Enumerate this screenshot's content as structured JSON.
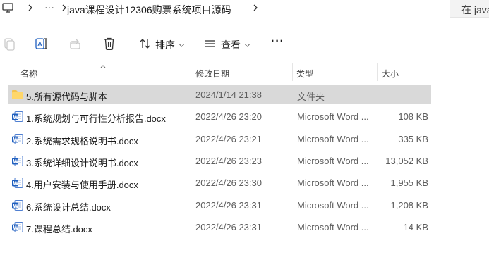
{
  "address": {
    "ellipsis": "···",
    "path": "java课程设计12306购票系统项目源码",
    "search_placeholder": "在 java"
  },
  "toolbar": {
    "sort_label": "排序",
    "view_label": "查看",
    "more_label": "···"
  },
  "columns": {
    "name": "名称",
    "modified": "修改日期",
    "type": "类型",
    "size": "大小"
  },
  "files": [
    {
      "name": "5.所有源代码与脚本",
      "modified": "2024/1/14 21:38",
      "type": "文件夹",
      "size": "",
      "icon": "folder-icon",
      "selected": true
    },
    {
      "name": "1.系统规划与可行性分析报告.docx",
      "modified": "2022/4/26 23:20",
      "type": "Microsoft Word ...",
      "size": "108 KB",
      "icon": "word-doc-icon",
      "selected": false
    },
    {
      "name": "2.系统需求规格说明书.docx",
      "modified": "2022/4/26 23:21",
      "type": "Microsoft Word ...",
      "size": "335 KB",
      "icon": "word-doc-icon",
      "selected": false
    },
    {
      "name": "3.系统详细设计说明书.docx",
      "modified": "2022/4/26 23:23",
      "type": "Microsoft Word ...",
      "size": "13,052 KB",
      "icon": "word-doc-icon",
      "selected": false
    },
    {
      "name": "4.用户安装与使用手册.docx",
      "modified": "2022/4/26 23:30",
      "type": "Microsoft Word ...",
      "size": "1,955 KB",
      "icon": "word-doc-icon",
      "selected": false
    },
    {
      "name": "6.系统设计总结.docx",
      "modified": "2022/4/26 23:31",
      "type": "Microsoft Word ...",
      "size": "1,208 KB",
      "icon": "word-doc-icon",
      "selected": false
    },
    {
      "name": "7.课程总结.docx",
      "modified": "2022/4/26 23:31",
      "type": "Microsoft Word ...",
      "size": "14 KB",
      "icon": "word-doc-icon",
      "selected": false
    }
  ],
  "colors": {
    "selected_row": "#d9d9d9",
    "folder": "#f4c34e",
    "word_blue": "#1f5fbf"
  }
}
